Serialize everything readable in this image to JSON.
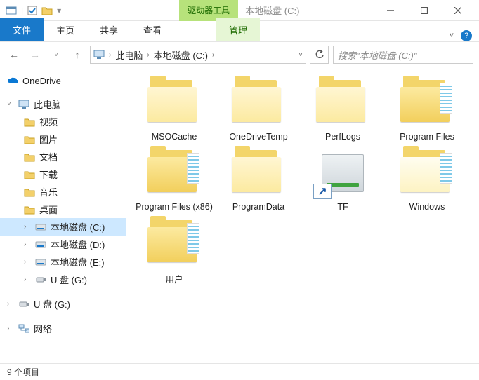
{
  "titlebar": {
    "ctx_tab": "驱动器工具",
    "title": "本地磁盘 (C:)"
  },
  "ribbon": {
    "file": "文件",
    "home": "主页",
    "share": "共享",
    "view": "查看",
    "manage": "管理"
  },
  "address": {
    "crumb1": "此电脑",
    "crumb2": "本地磁盘 (C:)"
  },
  "search": {
    "placeholder": "搜索\"本地磁盘 (C:)\""
  },
  "sidebar": {
    "onedrive": "OneDrive",
    "this_pc": "此电脑",
    "videos": "视频",
    "pictures": "图片",
    "documents": "文档",
    "downloads": "下载",
    "music": "音乐",
    "desktop": "桌面",
    "drive_c": "本地磁盘 (C:)",
    "drive_d": "本地磁盘 (D:)",
    "drive_e": "本地磁盘 (E:)",
    "usb_g": "U 盘 (G:)",
    "usb_g2": "U 盘 (G:)",
    "network": "网络"
  },
  "items": {
    "msocache": "MSOCache",
    "onedrivetemp": "OneDriveTemp",
    "perflogs": "PerfLogs",
    "programfiles": "Program Files",
    "programfiles86": "Program Files (x86)",
    "programdata": "ProgramData",
    "tf": "TF",
    "windows": "Windows",
    "users": "用户"
  },
  "status": {
    "count": "9 个项目"
  }
}
